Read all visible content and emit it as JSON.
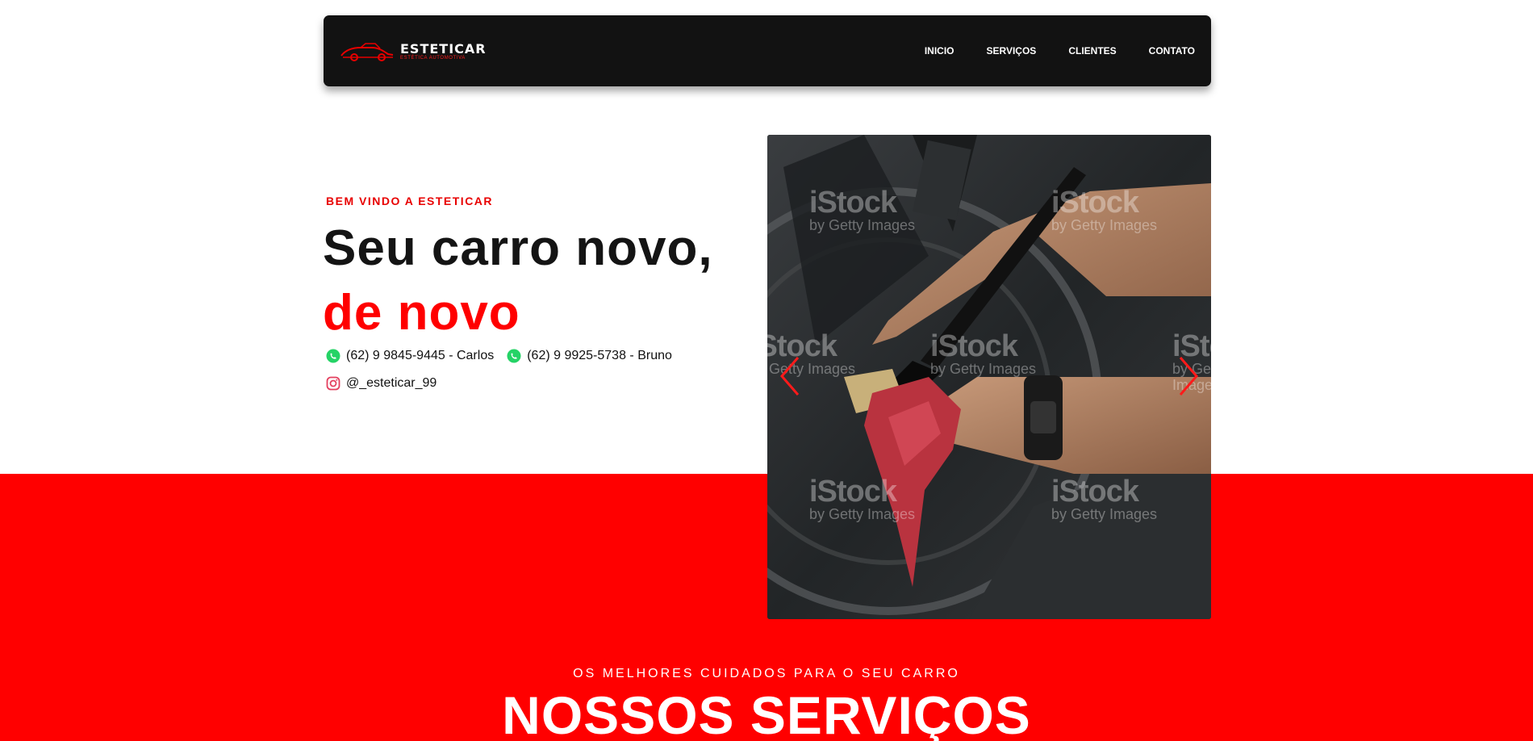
{
  "nav": {
    "logo_text": "ESTETICAR",
    "logo_subtext": "ESTÉTICA AUTOMOTIVA",
    "links": [
      {
        "label": "INICIO"
      },
      {
        "label": "SERVIÇOS"
      },
      {
        "label": "CLIENTES"
      },
      {
        "label": "CONTATO"
      }
    ]
  },
  "hero": {
    "welcome": "BEM VINDO A ESTETICAR",
    "headline_line1": "Seu carro novo,",
    "headline_line2": "de novo",
    "contacts": {
      "phone_carlos": "(62) 9 9845-9445 - Carlos",
      "phone_bruno": "(62) 9 9925-5738 - Bruno",
      "instagram": "@_esteticar_99"
    }
  },
  "carousel": {
    "watermark": "iStock",
    "watermark_sub": "by Getty Images",
    "prev_icon": "chevron-left-icon",
    "next_icon": "chevron-right-icon"
  },
  "services": {
    "subtitle": "OS MELHORES CUIDADOS PARA O SEU CARRO",
    "title": "NOSSOS SERVIÇOS"
  },
  "colors": {
    "accent_red": "#ff0000",
    "navbar_bg": "#121212",
    "whatsapp_green": "#25d366",
    "instagram_red": "#e4405f"
  }
}
